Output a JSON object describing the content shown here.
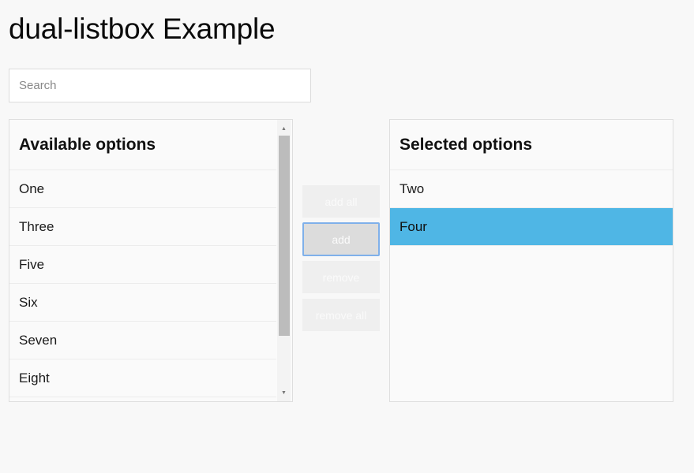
{
  "page": {
    "title": "dual-listbox Example"
  },
  "search": {
    "placeholder": "Search",
    "value": ""
  },
  "available": {
    "title": "Available options",
    "items": [
      "One",
      "Three",
      "Five",
      "Six",
      "Seven",
      "Eight"
    ]
  },
  "selected": {
    "title": "Selected options",
    "items": [
      "Two",
      "Four"
    ],
    "highlighted_index": 1
  },
  "buttons": {
    "add_all": "add all",
    "add": "add",
    "remove": "remove",
    "remove_all": "remove all"
  },
  "scrollbar": {
    "up_icon": "▲",
    "down_icon": "▼"
  },
  "colors": {
    "highlight": "#4fb6e5",
    "focus_border": "#7fb0ea"
  }
}
